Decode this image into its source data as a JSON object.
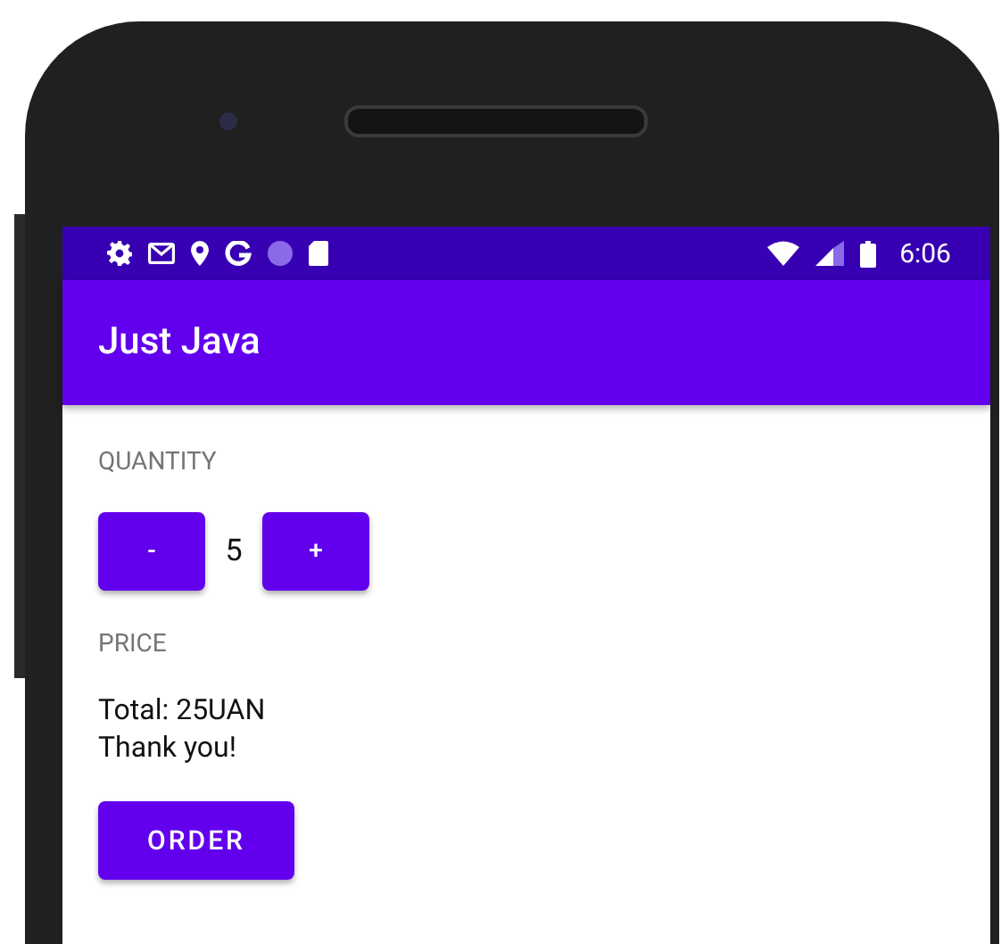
{
  "status_bar": {
    "time": "6:06"
  },
  "app_bar": {
    "title": "Just Java"
  },
  "quantity": {
    "label": "QUANTITY",
    "decrement": "-",
    "value": "5",
    "increment": "+"
  },
  "price": {
    "label": "PRICE",
    "summary_lines": [
      "Total: 25UAN",
      "Thank you!"
    ]
  },
  "order_button": "ORDER"
}
